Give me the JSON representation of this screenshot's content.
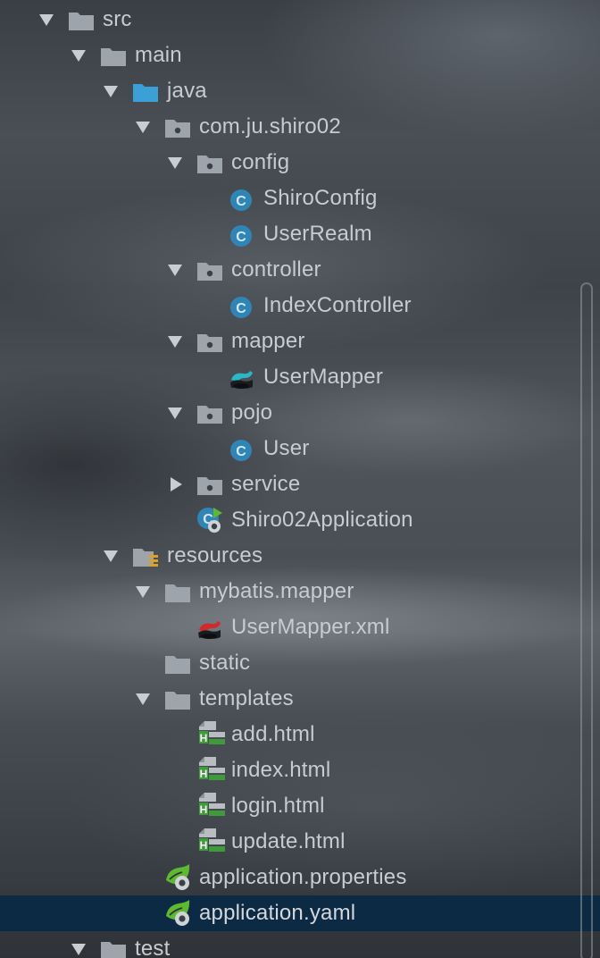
{
  "project_tree": {
    "rows": [
      {
        "label": "src",
        "icon": "folder-icon",
        "arrow": "expanded"
      },
      {
        "label": "main",
        "icon": "folder-icon",
        "arrow": "expanded"
      },
      {
        "label": "java",
        "icon": "source-folder-icon",
        "arrow": "expanded"
      },
      {
        "label": "com.ju.shiro02",
        "icon": "package-icon",
        "arrow": "expanded"
      },
      {
        "label": "config",
        "icon": "package-icon",
        "arrow": "expanded"
      },
      {
        "label": "ShiroConfig",
        "icon": "java-class-icon",
        "arrow": "none"
      },
      {
        "label": "UserRealm",
        "icon": "java-class-icon",
        "arrow": "none"
      },
      {
        "label": "controller",
        "icon": "package-icon",
        "arrow": "expanded"
      },
      {
        "label": "IndexController",
        "icon": "java-class-icon",
        "arrow": "none"
      },
      {
        "label": "mapper",
        "icon": "package-icon",
        "arrow": "expanded"
      },
      {
        "label": "UserMapper",
        "icon": "mybatis-interface-icon",
        "arrow": "none"
      },
      {
        "label": "pojo",
        "icon": "package-icon",
        "arrow": "expanded"
      },
      {
        "label": "User",
        "icon": "java-class-icon",
        "arrow": "none"
      },
      {
        "label": "service",
        "icon": "package-icon",
        "arrow": "collapsed"
      },
      {
        "label": "Shiro02Application",
        "icon": "spring-boot-app-icon",
        "arrow": "none"
      },
      {
        "label": "resources",
        "icon": "resources-folder-icon",
        "arrow": "expanded"
      },
      {
        "label": "mybatis.mapper",
        "icon": "folder-icon",
        "arrow": "expanded"
      },
      {
        "label": "UserMapper.xml",
        "icon": "mybatis-xml-icon",
        "arrow": "none"
      },
      {
        "label": "static",
        "icon": "folder-icon",
        "arrow": "none"
      },
      {
        "label": "templates",
        "icon": "folder-icon",
        "arrow": "expanded"
      },
      {
        "label": "add.html",
        "icon": "html-file-icon",
        "arrow": "none"
      },
      {
        "label": "index.html",
        "icon": "html-file-icon",
        "arrow": "none"
      },
      {
        "label": "login.html",
        "icon": "html-file-icon",
        "arrow": "none"
      },
      {
        "label": "update.html",
        "icon": "html-file-icon",
        "arrow": "none"
      },
      {
        "label": "application.properties",
        "icon": "spring-config-icon",
        "arrow": "none"
      },
      {
        "label": "application.yaml",
        "icon": "spring-config-icon",
        "arrow": "none",
        "selected": true
      },
      {
        "label": "test",
        "icon": "folder-icon",
        "arrow": "expanded"
      }
    ]
  },
  "colors": {
    "text": "#c8cbcf",
    "folder": "#9ea4ab",
    "source_folder": "#3aa0d6",
    "java_class": "#2f86b4",
    "html_green": "#3f9a3c",
    "spring_green": "#5fb832",
    "selection": "#0d2a45"
  }
}
